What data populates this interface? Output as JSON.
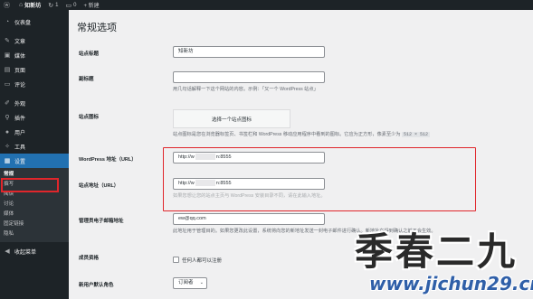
{
  "adminbar": {
    "site_name": "知新坊",
    "updates_count": "1",
    "comments_count": "0",
    "new_label": "+ 新建"
  },
  "sidebar": {
    "items": [
      {
        "label": "仪表盘",
        "icon": "dashboard-icon",
        "glyph": "◔"
      },
      {
        "label": "文章",
        "icon": "pin-icon",
        "glyph": "✎"
      },
      {
        "label": "媒体",
        "icon": "media-icon",
        "glyph": "▣"
      },
      {
        "label": "页面",
        "icon": "page-icon",
        "glyph": "▤"
      },
      {
        "label": "评论",
        "icon": "comment-icon",
        "glyph": "▭"
      },
      {
        "label": "外观",
        "icon": "brush-icon",
        "glyph": "✐"
      },
      {
        "label": "插件",
        "icon": "plugin-icon",
        "glyph": "⚲"
      },
      {
        "label": "用户",
        "icon": "user-icon",
        "glyph": "●"
      },
      {
        "label": "工具",
        "icon": "wrench-icon",
        "glyph": "✧"
      },
      {
        "label": "设置",
        "icon": "settings-icon",
        "glyph": "▦"
      }
    ],
    "submenu": [
      "常规",
      "撰写",
      "阅读",
      "讨论",
      "媒体",
      "固定链接",
      "隐私"
    ],
    "collapse_label": "收起菜单"
  },
  "page": {
    "title": "常规选项",
    "site_title": {
      "label": "站点标题",
      "value": "知新坊"
    },
    "tagline": {
      "label": "副标题",
      "value": "",
      "desc": "用几句话解释一下这个网站的内容。示例：「又一个 WordPress 站点」"
    },
    "site_icon": {
      "label": "站点图标",
      "button": "选择一个站点图标",
      "desc": "站点图标是您在浏览器标签页、书签栏和 WordPress 移动应用程序中看到的图标。它应为正方形，像素至少为",
      "size": "512 × 512"
    },
    "wp_address": {
      "label": "WordPress 地址（URL）",
      "prefix": "http://w",
      "suffix": "n:8555"
    },
    "site_address": {
      "label": "站点地址（URL）",
      "prefix": "http://w",
      "suffix": "n:8555",
      "desc": "如果您想让您的站点主页与 WordPress 安装目录不同，请在此输入地址。"
    },
    "admin_email": {
      "label": "管理员电子邮箱地址",
      "value": "ew@qq.com",
      "desc": "此地址用于管理目的。如果您更改此设置，系统将向您的新地址发送一封电子邮件进行确认。新地址在得到确认之前不会生效。"
    },
    "membership": {
      "label": "成员资格",
      "checkbox_label": "任何人都可以注册"
    },
    "default_role": {
      "label": "新用户默认角色",
      "value": "订阅者"
    }
  },
  "watermark": {
    "title": "季春二九",
    "url": "www.jichun29.cn"
  },
  "colors": {
    "admin_bar": "#1d2327",
    "accent": "#2271b1",
    "highlight": "#e0262b"
  }
}
